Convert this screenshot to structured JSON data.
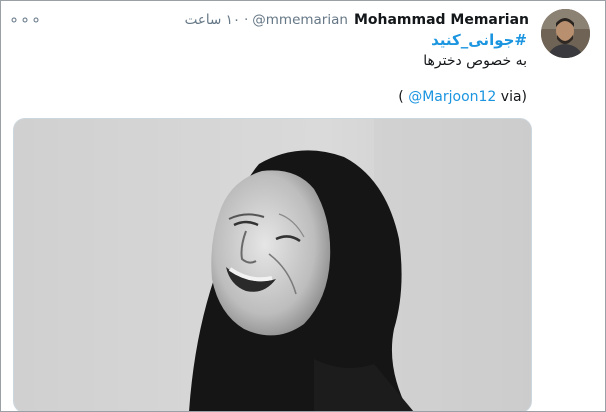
{
  "tweet": {
    "author_name": "Mohammad Memarian",
    "handle": "@mmemarian",
    "separator": "·",
    "timestamp": "۱۰ ساعت",
    "more_icon": "more-horizontal-icon",
    "hashtag": "#جوانی_کنید",
    "body_text": "به خصوص دخترها",
    "via_open": "(",
    "via_mention": "@Marjoon12",
    "via_close": " via)",
    "photo_subject": "black and white portrait photo of a smiling woman in a black headscarf"
  },
  "colors": {
    "link": "#1b95e0",
    "text": "#14171a",
    "secondary": "#657786"
  }
}
